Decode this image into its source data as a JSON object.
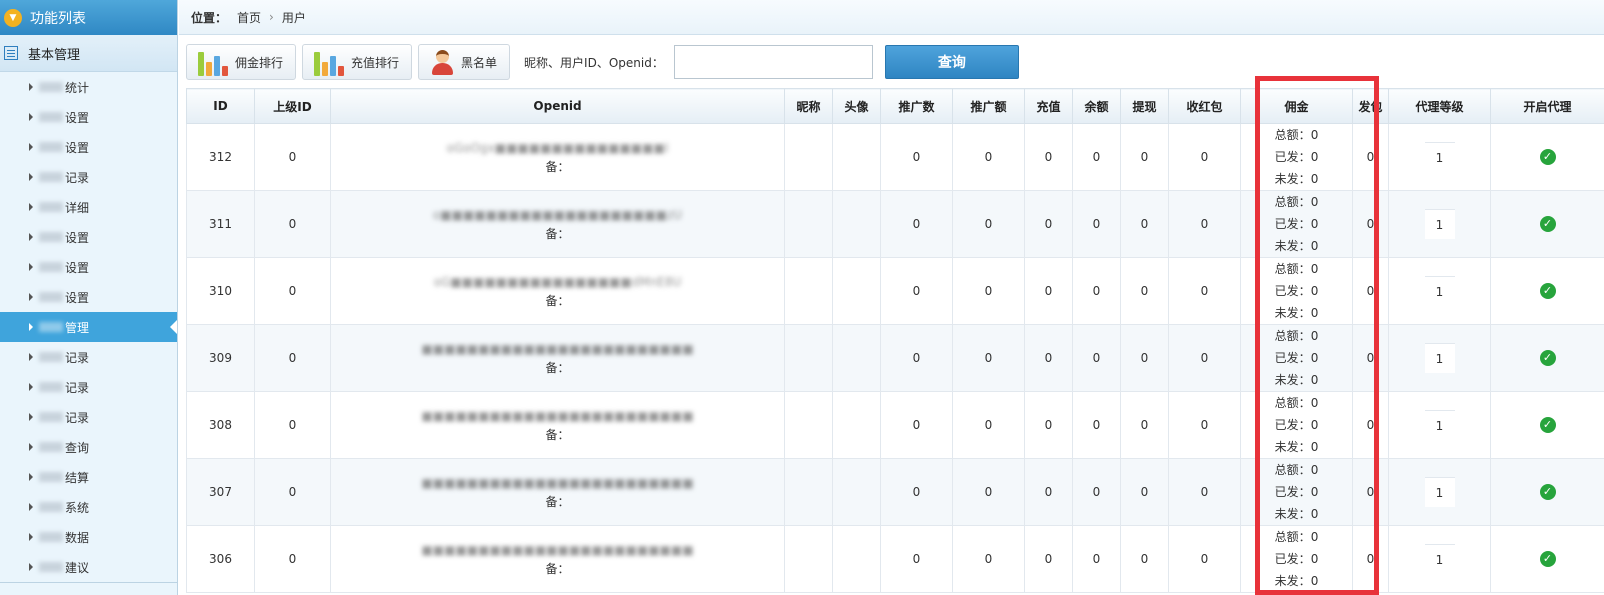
{
  "sidebar": {
    "header": "功能列表",
    "group": "基本管理",
    "items": [
      {
        "label": "统计",
        "active": false
      },
      {
        "label": "设置",
        "active": false
      },
      {
        "label": "设置",
        "active": false
      },
      {
        "label": "记录",
        "active": false
      },
      {
        "label": "详细",
        "active": false
      },
      {
        "label": "设置",
        "active": false
      },
      {
        "label": "设置",
        "active": false
      },
      {
        "label": "设置",
        "active": false
      },
      {
        "label": "管理",
        "active": true
      },
      {
        "label": "记录",
        "active": false
      },
      {
        "label": "记录",
        "active": false
      },
      {
        "label": "记录",
        "active": false
      },
      {
        "label": "查询",
        "active": false
      },
      {
        "label": "结算",
        "active": false
      },
      {
        "label": "系统",
        "active": false
      },
      {
        "label": "数据",
        "active": false
      },
      {
        "label": "建议",
        "active": false
      }
    ]
  },
  "breadcrumb": {
    "label": "位置：",
    "home": "首页",
    "sep": "›",
    "current": "用户"
  },
  "toolbar": {
    "commission_rank": "佣金排行",
    "recharge_rank": "充值排行",
    "blacklist": "黑名单",
    "search_label": "昵称、用户ID、Openid：",
    "search_value": "",
    "query": "查询"
  },
  "table": {
    "headers": {
      "id": "ID",
      "parent": "上级ID",
      "openid": "Openid",
      "nick": "昵称",
      "avatar": "头像",
      "promo_count": "推广数",
      "promo_amount": "推广额",
      "recharge": "充值",
      "balance": "余额",
      "withdraw": "提现",
      "receive": "收红包",
      "commission": "佣金",
      "send": "发包",
      "level": "代理等级",
      "agent": "开启代理"
    },
    "commission_labels": {
      "total": "总额：",
      "paid": "已发：",
      "unpaid": "未发："
    },
    "remark_label": "备：",
    "rows": [
      {
        "id": "312",
        "parent": "0",
        "openid": "oGoOgx■■■■■■■■■■■■■■■I",
        "promo_count": "0",
        "promo_amount": "0",
        "recharge": "0",
        "balance": "0",
        "withdraw": "0",
        "receive": "0",
        "total": "0",
        "paid": "0",
        "unpaid": "0",
        "send": "0",
        "level": "1"
      },
      {
        "id": "311",
        "parent": "0",
        "openid": "o■■■■■■■■■■■■■■■■■■■■zU",
        "promo_count": "0",
        "promo_amount": "0",
        "recharge": "0",
        "balance": "0",
        "withdraw": "0",
        "receive": "0",
        "total": "0",
        "paid": "0",
        "unpaid": "0",
        "send": "0",
        "level": "1"
      },
      {
        "id": "310",
        "parent": "0",
        "openid": "oG■■■■■■■■■■■■■■■■dMnE8U",
        "promo_count": "0",
        "promo_amount": "0",
        "recharge": "0",
        "balance": "0",
        "withdraw": "0",
        "receive": "0",
        "total": "0",
        "paid": "0",
        "unpaid": "0",
        "send": "0",
        "level": "1"
      },
      {
        "id": "309",
        "parent": "0",
        "openid": "■■■■■■■■■■■■■■■■■■■■■■■■",
        "promo_count": "0",
        "promo_amount": "0",
        "recharge": "0",
        "balance": "0",
        "withdraw": "0",
        "receive": "0",
        "total": "0",
        "paid": "0",
        "unpaid": "0",
        "send": "0",
        "level": "1"
      },
      {
        "id": "308",
        "parent": "0",
        "openid": "■■■■■■■■■■■■■■■■■■■■■■■■",
        "promo_count": "0",
        "promo_amount": "0",
        "recharge": "0",
        "balance": "0",
        "withdraw": "0",
        "receive": "0",
        "total": "0",
        "paid": "0",
        "unpaid": "0",
        "send": "0",
        "level": "1"
      },
      {
        "id": "307",
        "parent": "0",
        "openid": "■■■■■■■■■■■■■■■■■■■■■■■■",
        "promo_count": "0",
        "promo_amount": "0",
        "recharge": "0",
        "balance": "0",
        "withdraw": "0",
        "receive": "0",
        "total": "0",
        "paid": "0",
        "unpaid": "0",
        "send": "0",
        "level": "1"
      },
      {
        "id": "306",
        "parent": "0",
        "openid": "■■■■■■■■■■■■■■■■■■■■■■■■",
        "promo_count": "0",
        "promo_amount": "0",
        "recharge": "0",
        "balance": "0",
        "withdraw": "0",
        "receive": "0",
        "total": "0",
        "paid": "0",
        "unpaid": "0",
        "send": "0",
        "level": "1"
      }
    ]
  },
  "colors": {
    "accent": "#3fa4dc",
    "highlight": "#e8323a",
    "check": "#27a43c"
  }
}
